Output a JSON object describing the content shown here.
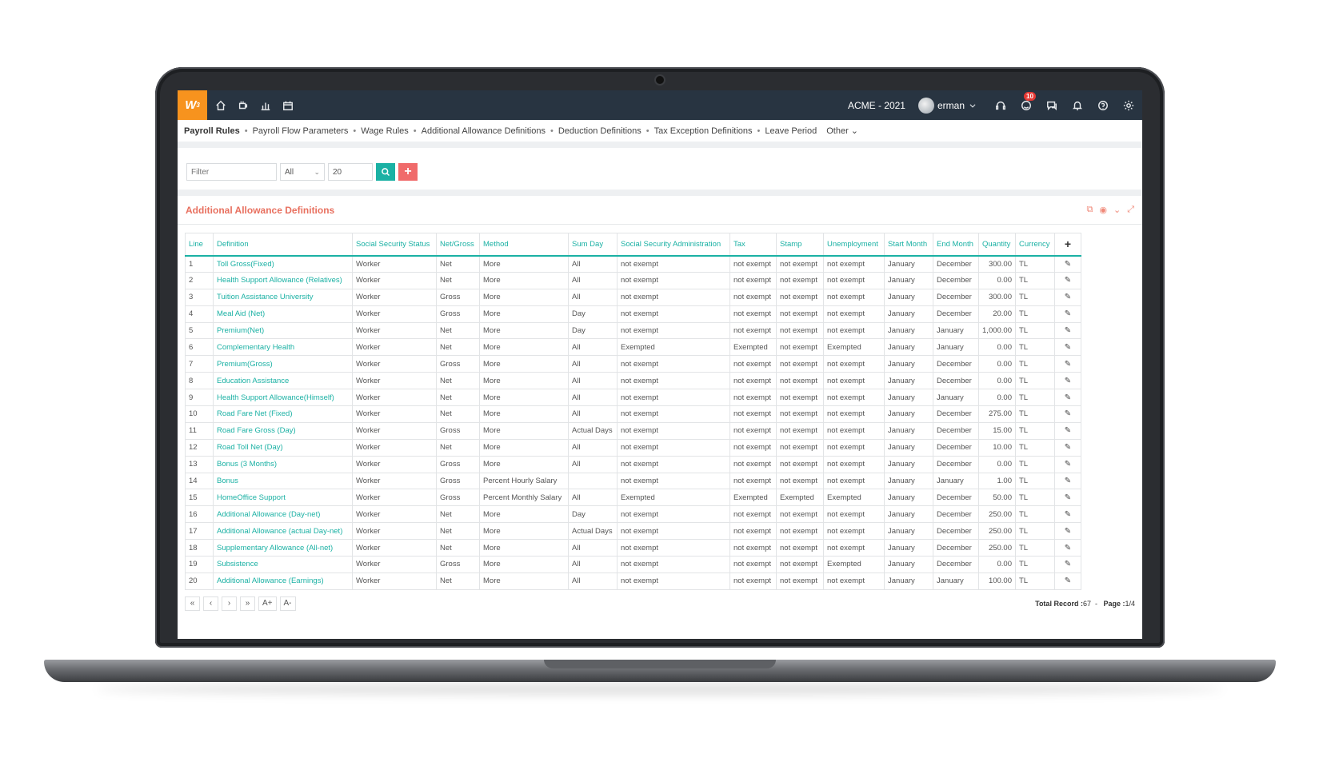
{
  "app": {
    "logo_text": "W",
    "logo_sup": "3",
    "company": "ACME - 2021",
    "user": "erman",
    "notification_count": "10",
    "accent_color": "#1bb1a4",
    "brand_color": "#f7931e",
    "title_color": "#e8705f"
  },
  "tabs": [
    {
      "label": "Payroll Rules"
    },
    {
      "label": "Payroll Flow Parameters"
    },
    {
      "label": "Wage Rules"
    },
    {
      "label": "Additional Allowance Definitions"
    },
    {
      "label": "Deduction Definitions"
    },
    {
      "label": "Tax Exception Definitions"
    },
    {
      "label": "Leave Period"
    },
    {
      "label": "Other"
    }
  ],
  "filter": {
    "placeholder": "Filter",
    "select_value": "All",
    "page_size": "20"
  },
  "panel": {
    "title": "Additional Allowance Definitions"
  },
  "table": {
    "columns": [
      "Line",
      "Definition",
      "Social Security Status",
      "Net/Gross",
      "Method",
      "Sum Day",
      "Social Security Administration",
      "Tax",
      "Stamp",
      "Unemployment",
      "Start Month",
      "End Month",
      "Quantity",
      "Currency",
      "+"
    ],
    "rows": [
      [
        "1",
        "Toll Gross(Fixed)",
        "Worker",
        "Net",
        "More",
        "All",
        "not exempt",
        "not exempt",
        "not exempt",
        "not exempt",
        "January",
        "December",
        "300.00",
        "TL"
      ],
      [
        "2",
        "Health Support Allowance (Relatives)",
        "Worker",
        "Net",
        "More",
        "All",
        "not exempt",
        "not exempt",
        "not exempt",
        "not exempt",
        "January",
        "December",
        "0.00",
        "TL"
      ],
      [
        "3",
        "Tuition Assistance University",
        "Worker",
        "Gross",
        "More",
        "All",
        "not exempt",
        "not exempt",
        "not exempt",
        "not exempt",
        "January",
        "December",
        "300.00",
        "TL"
      ],
      [
        "4",
        "Meal Aid (Net)",
        "Worker",
        "Gross",
        "More",
        "Day",
        "not exempt",
        "not exempt",
        "not exempt",
        "not exempt",
        "January",
        "December",
        "20.00",
        "TL"
      ],
      [
        "5",
        "Premium(Net)",
        "Worker",
        "Net",
        "More",
        "Day",
        "not exempt",
        "not exempt",
        "not exempt",
        "not exempt",
        "January",
        "January",
        "1,000.00",
        "TL"
      ],
      [
        "6",
        "Complementary Health",
        "Worker",
        "Net",
        "More",
        "All",
        "Exempted",
        "Exempted",
        "not exempt",
        "Exempted",
        "January",
        "January",
        "0.00",
        "TL"
      ],
      [
        "7",
        "Premium(Gross)",
        "Worker",
        "Gross",
        "More",
        "All",
        "not exempt",
        "not exempt",
        "not exempt",
        "not exempt",
        "January",
        "December",
        "0.00",
        "TL"
      ],
      [
        "8",
        "Education Assistance",
        "Worker",
        "Net",
        "More",
        "All",
        "not exempt",
        "not exempt",
        "not exempt",
        "not exempt",
        "January",
        "December",
        "0.00",
        "TL"
      ],
      [
        "9",
        "Health Support Allowance(Himself)",
        "Worker",
        "Net",
        "More",
        "All",
        "not exempt",
        "not exempt",
        "not exempt",
        "not exempt",
        "January",
        "January",
        "0.00",
        "TL"
      ],
      [
        "10",
        "Road Fare Net (Fixed)",
        "Worker",
        "Net",
        "More",
        "All",
        "not exempt",
        "not exempt",
        "not exempt",
        "not exempt",
        "January",
        "December",
        "275.00",
        "TL"
      ],
      [
        "11",
        "Road Fare Gross (Day)",
        "Worker",
        "Gross",
        "More",
        "Actual Days",
        "not exempt",
        "not exempt",
        "not exempt",
        "not exempt",
        "January",
        "December",
        "15.00",
        "TL"
      ],
      [
        "12",
        "Road Toll Net (Day)",
        "Worker",
        "Net",
        "More",
        "All",
        "not exempt",
        "not exempt",
        "not exempt",
        "not exempt",
        "January",
        "December",
        "10.00",
        "TL"
      ],
      [
        "13",
        "Bonus (3 Months)",
        "Worker",
        "Gross",
        "More",
        "All",
        "not exempt",
        "not exempt",
        "not exempt",
        "not exempt",
        "January",
        "December",
        "0.00",
        "TL"
      ],
      [
        "14",
        "Bonus",
        "Worker",
        "Gross",
        "Percent Hourly Salary",
        "",
        "not exempt",
        "not exempt",
        "not exempt",
        "not exempt",
        "January",
        "January",
        "1.00",
        "TL"
      ],
      [
        "15",
        "HomeOffice Support",
        "Worker",
        "Gross",
        "Percent Monthly Salary",
        "All",
        "Exempted",
        "Exempted",
        "Exempted",
        "Exempted",
        "January",
        "December",
        "50.00",
        "TL"
      ],
      [
        "16",
        "Additional Allowance (Day-net)",
        "Worker",
        "Net",
        "More",
        "Day",
        "not exempt",
        "not exempt",
        "not exempt",
        "not exempt",
        "January",
        "December",
        "250.00",
        "TL"
      ],
      [
        "17",
        "Additional Allowance (actual Day-net)",
        "Worker",
        "Net",
        "More",
        "Actual Days",
        "not exempt",
        "not exempt",
        "not exempt",
        "not exempt",
        "January",
        "December",
        "250.00",
        "TL"
      ],
      [
        "18",
        "Supplementary Allowance (All-net)",
        "Worker",
        "Net",
        "More",
        "All",
        "not exempt",
        "not exempt",
        "not exempt",
        "not exempt",
        "January",
        "December",
        "250.00",
        "TL"
      ],
      [
        "19",
        "Subsistence",
        "Worker",
        "Gross",
        "More",
        "All",
        "not exempt",
        "not exempt",
        "not exempt",
        "Exempted",
        "January",
        "December",
        "0.00",
        "TL"
      ],
      [
        "20",
        "Additional Allowance (Earnings)",
        "Worker",
        "Net",
        "More",
        "All",
        "not exempt",
        "not exempt",
        "not exempt",
        "not exempt",
        "January",
        "January",
        "100.00",
        "TL"
      ]
    ]
  },
  "pager": {
    "first": "«",
    "prev": "‹",
    "next": "›",
    "last": "»",
    "font_up": "A+",
    "font_down": "A-",
    "total_label": "Total Record :",
    "total_value": "67",
    "page_label": "Page :",
    "page_value": "1/4"
  }
}
